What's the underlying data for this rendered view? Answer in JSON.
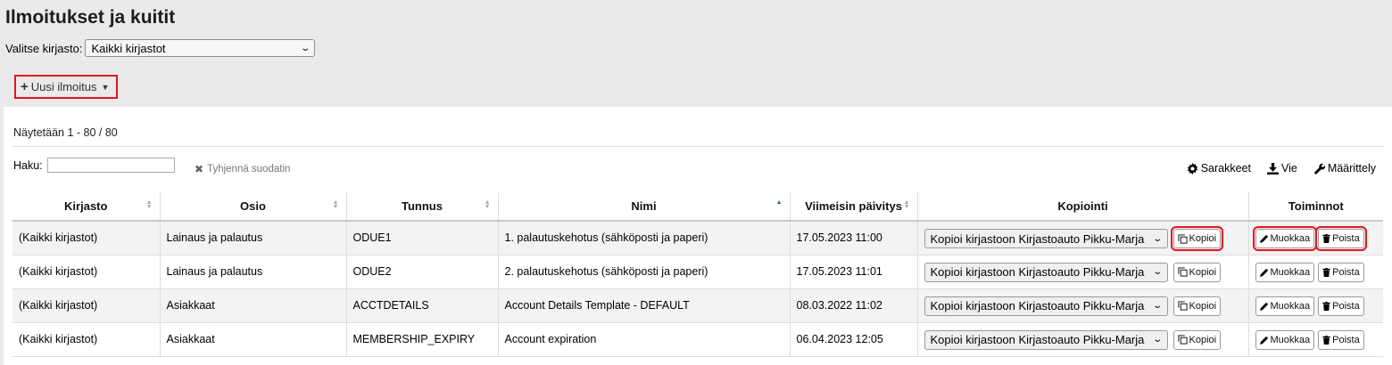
{
  "page": {
    "title": "Ilmoitukset ja kuitit"
  },
  "library_select": {
    "label": "Valitse kirjasto:",
    "value": "Kaikki kirjastot"
  },
  "new_notice": {
    "label": "Uusi ilmoitus"
  },
  "table_info": {
    "showing": "Näytetään 1 - 80 / 80"
  },
  "filter": {
    "label": "Haku:",
    "value": "",
    "clear_label": "Tyhjennä suodatin"
  },
  "toolbar": {
    "columns_label": "Sarakkeet",
    "export_label": "Vie",
    "settings_label": "Määrittely"
  },
  "columns": [
    "Kirjasto",
    "Osio",
    "Tunnus",
    "Nimi",
    "Viimeisin päivitys",
    "Kopiointi",
    "Toiminnot"
  ],
  "rows": [
    {
      "library": "(Kaikki kirjastot)",
      "module": "Lainaus ja palautus",
      "code": "ODUE1",
      "name": "1. palautuskehotus (sähköposti ja paperi)",
      "updated": "17.05.2023 11:00",
      "copy_target": "Kopioi kirjastoon Kirjastoauto Pikku-Marja",
      "copy_label": "Kopioi",
      "edit_label": "Muokkaa",
      "delete_label": "Poista"
    },
    {
      "library": "(Kaikki kirjastot)",
      "module": "Lainaus ja palautus",
      "code": "ODUE2",
      "name": "2. palautuskehotus (sähköposti ja paperi)",
      "updated": "17.05.2023 11:01",
      "copy_target": "Kopioi kirjastoon Kirjastoauto Pikku-Marja",
      "copy_label": "Kopioi",
      "edit_label": "Muokkaa",
      "delete_label": "Poista"
    },
    {
      "library": "(Kaikki kirjastot)",
      "module": "Asiakkaat",
      "code": "ACCTDETAILS",
      "name": "Account Details Template - DEFAULT",
      "updated": "08.03.2022 11:02",
      "copy_target": "Kopioi kirjastoon Kirjastoauto Pikku-Marja",
      "copy_label": "Kopioi",
      "edit_label": "Muokkaa",
      "delete_label": "Poista"
    },
    {
      "library": "(Kaikki kirjastot)",
      "module": "Asiakkaat",
      "code": "MEMBERSHIP_EXPIRY",
      "name": "Account expiration",
      "updated": "06.04.2023 12:05",
      "copy_target": "Kopioi kirjastoon Kirjastoauto Pikku-Marja",
      "copy_label": "Kopioi",
      "edit_label": "Muokkaa",
      "delete_label": "Poista"
    }
  ],
  "colors": {
    "highlight": "#e0161f",
    "sort_active": "#1b6bb5"
  }
}
